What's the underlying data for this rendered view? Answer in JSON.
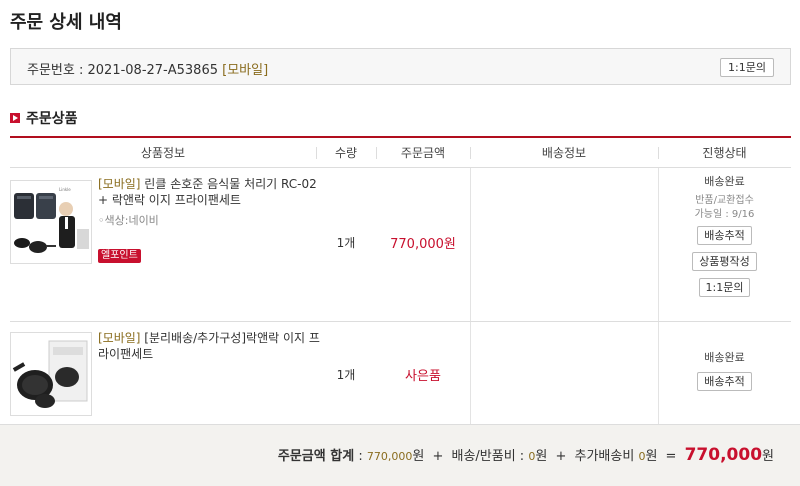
{
  "page": {
    "title": "주문 상세 내역"
  },
  "order": {
    "label": "주문번호 : ",
    "number": "2021-08-27-A53865",
    "channel": "[모바일]",
    "qna_button": "1:1문의"
  },
  "section": {
    "title": "주문상품"
  },
  "table": {
    "headers": {
      "product": "상품정보",
      "qty": "수량",
      "price": "주문금액",
      "delivery": "배송정보",
      "status": "진행상태"
    }
  },
  "items": [
    {
      "tag": "[모바일]",
      "name": " 린클 손호준 음식물 처리기 RC-02 + 락앤락 이지 프라이팬세트",
      "option": "색상:네이비",
      "point_badge": "엘포인트",
      "qty": "1개",
      "price": "770,000원",
      "status": "배송완료",
      "return_note_1": "반품/교환접수",
      "return_note_2": "가능일 : 9/16",
      "btn_track": "배송추적",
      "btn_review": "상품평작성",
      "btn_qna": "1:1문의"
    },
    {
      "tag": "[모바일]",
      "name": " [분리배송/추가구성]락앤락 이지 프라이팬세트",
      "qty": "1개",
      "price": "사은품",
      "status": "배송완료",
      "btn_track": "배송추적"
    }
  ],
  "totals": {
    "label": "주문금액 합계",
    "order_amount": "770,000",
    "won": "원",
    "shipping_label": "배송/반품비",
    "shipping_amount": "0",
    "extra_label": "추가배송비",
    "extra_amount": "0",
    "grand_total": "770,000"
  },
  "colors": {
    "accent": "#c8102e",
    "tag": "#8a6d1f"
  }
}
